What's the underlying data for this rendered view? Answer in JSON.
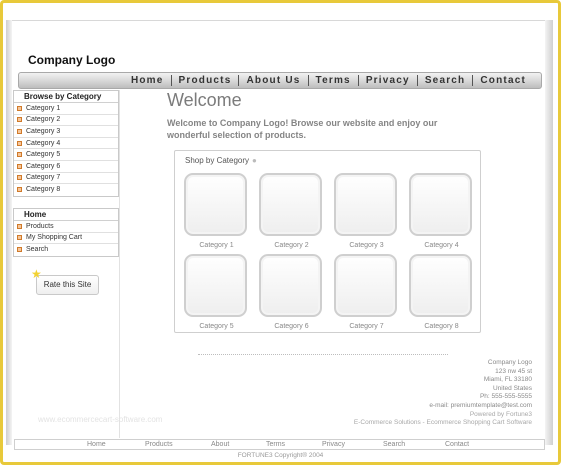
{
  "header": {
    "logo": "Company Logo"
  },
  "nav": [
    "Home",
    "Products",
    "About Us",
    "Terms",
    "Privacy",
    "Search",
    "Contact"
  ],
  "sidebar": {
    "browse_title": "Browse by Category",
    "categories": [
      "Category 1",
      "Category 2",
      "Category 3",
      "Category 4",
      "Category 5",
      "Category 6",
      "Category 7",
      "Category 8"
    ],
    "links_title": "Home",
    "links": [
      "Products",
      "My Shopping Cart",
      "Search"
    ],
    "rate_button": "Rate this Site"
  },
  "main": {
    "title": "Welcome",
    "intro": "Welcome to  Company Logo! Browse our website and enjoy our wonderful selection of products.",
    "shop_title": "Shop by Category",
    "shop_items": [
      "Category 1",
      "Category 2",
      "Category 3",
      "Category 4",
      "Category 5",
      "Category 6",
      "Category 7",
      "Category 8"
    ]
  },
  "address": {
    "company": "Company Logo",
    "street": "123 nw 45 st",
    "city": "Miami, FL 33180",
    "country": "United States",
    "phone": "Ph: 555-555-5555",
    "email": "e-mail: premiumtemplate@test.com",
    "powered": "Powered by Fortune3",
    "software": "E-Commerce Solutions - Ecommerce Shopping Cart Software"
  },
  "watermark": "www.ecommercecart-software.com",
  "footer": {
    "links": [
      "Home",
      "Products",
      "About",
      "Terms",
      "Privacy",
      "Search",
      "Contact"
    ],
    "copyright": "FORTUNE3 Copyright® 2004"
  },
  "colors": {
    "frame": "#e8c93a",
    "bullet": "#d07a2a",
    "star": "#f2d233"
  },
  "icons": {
    "bullet": "square-bullet-icon",
    "rate_star": "star-icon"
  }
}
